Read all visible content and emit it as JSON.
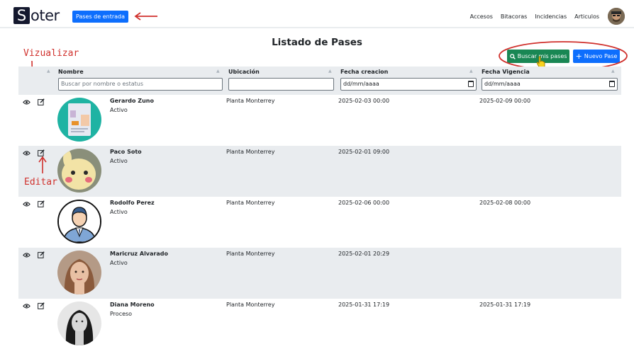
{
  "brand": {
    "logo_s": "S",
    "logo_rest": "oter"
  },
  "nav": {
    "active": "Pases de entrada",
    "links": [
      "Accesos",
      "Bitacoras",
      "Incidencias",
      "Articulos"
    ]
  },
  "page_title": "Listado de Pases",
  "annotations": {
    "vizualizar": "Vizualizar",
    "editar": "Editar"
  },
  "actions": {
    "buscar": "Buscar mis pases",
    "nuevo": "Nuevo Pase"
  },
  "table": {
    "columns": [
      "Nombre",
      "Ubicación",
      "Fecha creacion",
      "Fecha Vigencia"
    ],
    "filters": {
      "nombre_placeholder": "Buscar por nombre o estatus",
      "ubicacion_value": "",
      "fecha_creacion_value": "dd/mm/aaaa",
      "fecha_vigencia_value": "dd/mm/aaaa"
    },
    "rows": [
      {
        "nombre": "Gerardo Zuno",
        "estado": "Activo",
        "ubicacion": "Planta Monterrey",
        "fecha_creacion": "2025-02-03 00:00",
        "fecha_vigencia": "2025-02-09 00:00",
        "avatar": "id-card-avatar"
      },
      {
        "nombre": "Paco Soto",
        "estado": "Activo",
        "ubicacion": "Planta Monterrey",
        "fecha_creacion": "2025-02-01 09:00",
        "fecha_vigencia": "",
        "avatar": "plush-avatar"
      },
      {
        "nombre": "Rodolfo Perez",
        "estado": "Activo",
        "ubicacion": "Planta Monterrey",
        "fecha_creacion": "2025-02-06 00:00",
        "fecha_vigencia": "2025-02-08 00:00",
        "avatar": "businessman-avatar"
      },
      {
        "nombre": "Maricruz Alvarado",
        "estado": "Activo",
        "ubicacion": "Planta Monterrey",
        "fecha_creacion": "2025-02-01 20:29",
        "fecha_vigencia": "",
        "avatar": "woman-photo-avatar"
      },
      {
        "nombre": "Diana Moreno",
        "estado": "Proceso",
        "ubicacion": "Planta Monterrey",
        "fecha_creacion": "2025-01-31 17:19",
        "fecha_vigencia": "2025-01-31 17:19",
        "avatar": "bw-photo-avatar"
      }
    ]
  },
  "colors": {
    "primary": "#0d6efd",
    "success": "#198754",
    "annotation": "#d0312d",
    "stripe": "#e9ecef",
    "brand_dark": "#14182e"
  }
}
